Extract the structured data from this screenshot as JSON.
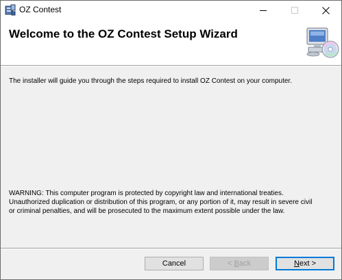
{
  "window": {
    "title": "OZ Contest",
    "controls": {
      "minimize_icon": "minimize-icon",
      "maximize_icon": "maximize-icon",
      "close_icon": "close-icon"
    }
  },
  "header": {
    "title": "Welcome to the OZ Contest Setup Wizard",
    "icon": "computer-cd-icon"
  },
  "body": {
    "intro": "The installer will guide you through the steps required to install OZ Contest on your computer.",
    "warning": "WARNING: This computer program is protected by copyright law and international treaties.\nUnauthorized duplication or distribution of this program, or any portion of it, may result in severe civil\nor criminal penalties, and will be prosecuted to the maximum extent possible under the law."
  },
  "buttons": {
    "cancel": "Cancel",
    "back": {
      "mnemonic": "B",
      "rest": "ack",
      "prefix": "< ",
      "enabled": false
    },
    "next": {
      "mnemonic": "N",
      "rest": "ext >",
      "enabled": true,
      "default": true
    }
  },
  "colors": {
    "focus_border": "#0078d7",
    "dialog_bg": "#f0f0f0"
  }
}
